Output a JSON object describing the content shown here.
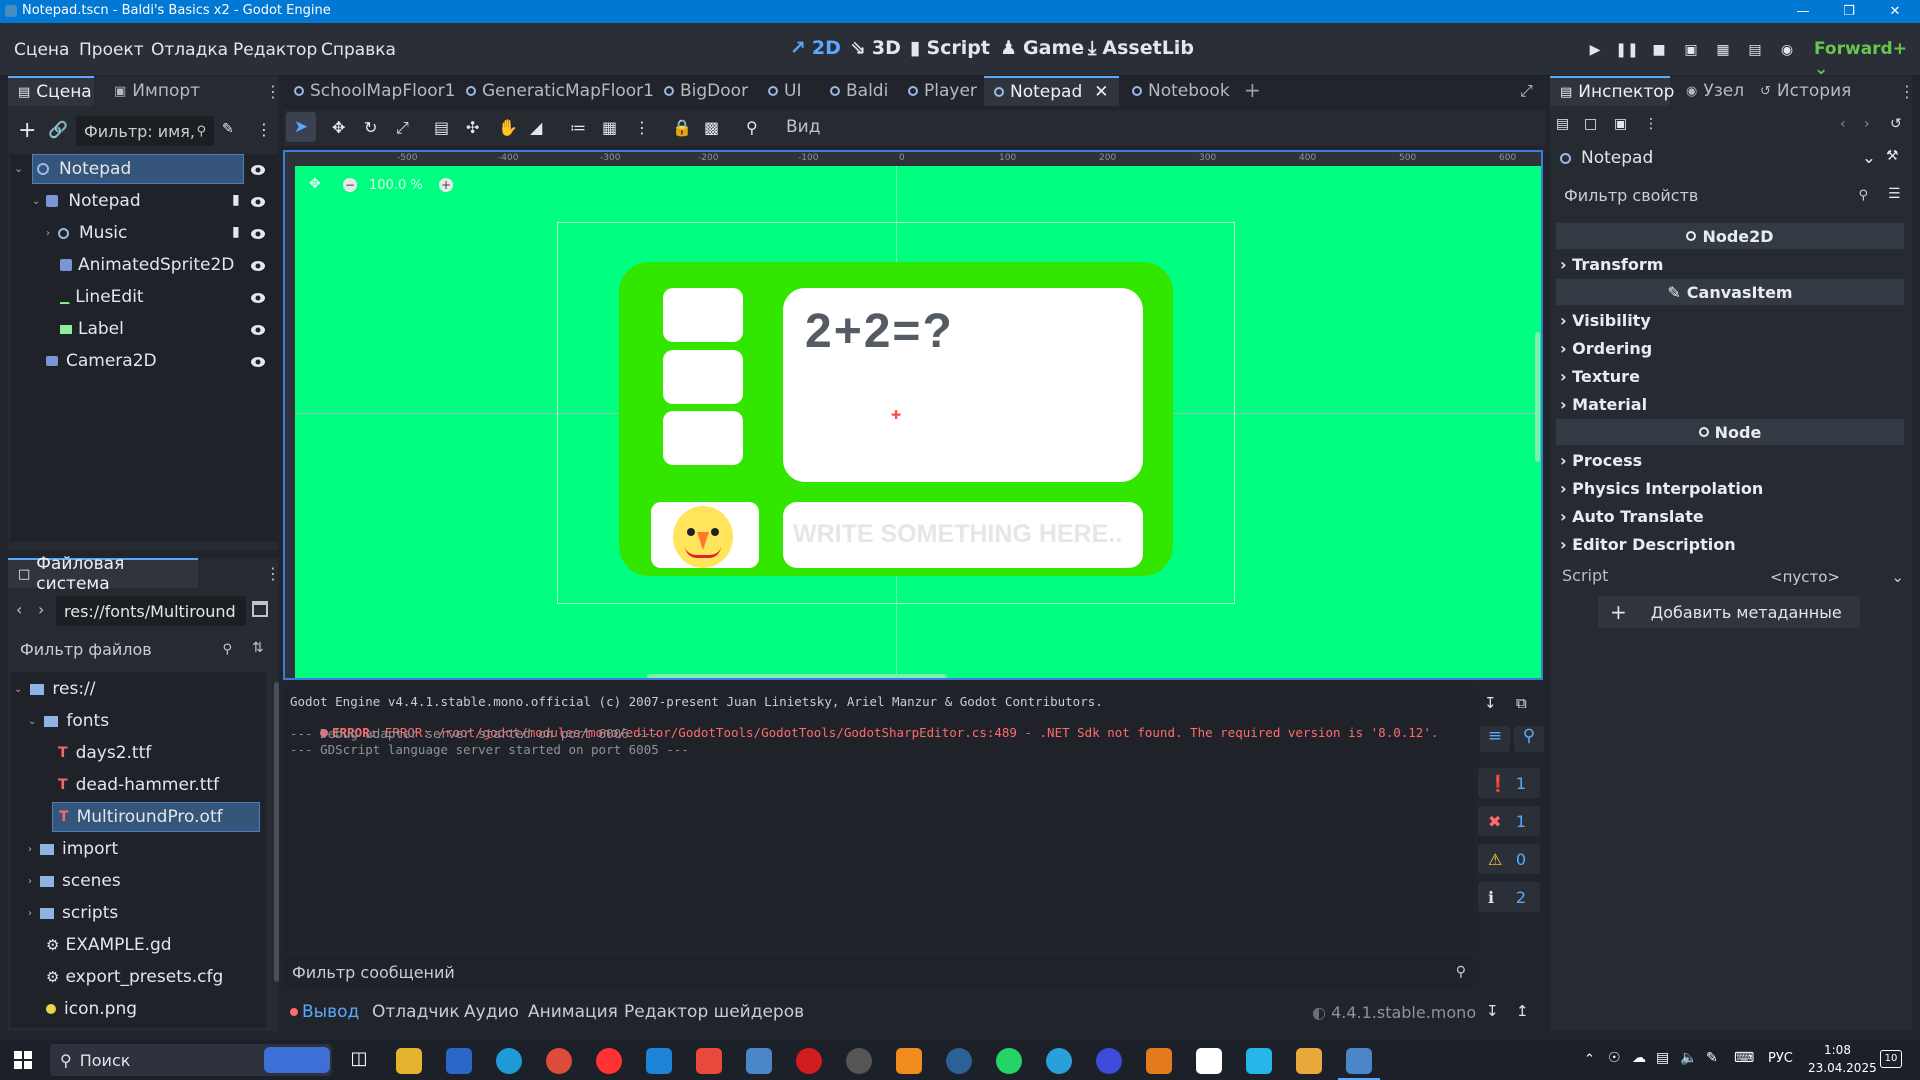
{
  "window": {
    "title": "Notepad.tscn - Baldi's Basics x2 - Godot Engine"
  },
  "menu": {
    "items": [
      "Сцена",
      "Проект",
      "Отладка",
      "Редактор",
      "Справка"
    ],
    "main_screens": [
      "2D",
      "3D",
      "Script",
      "Game",
      "AssetLib"
    ],
    "renderer": "Forward+"
  },
  "scene_dock": {
    "tabs": [
      "Сцена",
      "Импорт"
    ],
    "filter_placeholder": "Фильтр: имя,",
    "tree": [
      {
        "label": "Notepad",
        "icon": "node2d-icon"
      },
      {
        "label": "Notepad",
        "icon": "sprite-icon"
      },
      {
        "label": "Music",
        "icon": "audio-icon"
      },
      {
        "label": "AnimatedSprite2D",
        "icon": "animated-sprite-icon"
      },
      {
        "label": "LineEdit",
        "icon": "lineedit-icon"
      },
      {
        "label": "Label",
        "icon": "label-icon"
      },
      {
        "label": "Camera2D",
        "icon": "camera-icon"
      }
    ]
  },
  "filesystem_dock": {
    "title": "Файловая система",
    "path": "res://fonts/Multiround",
    "filter_placeholder": "Фильтр файлов",
    "tree": [
      {
        "label": "res://"
      },
      {
        "label": "fonts"
      },
      {
        "label": "days2.ttf"
      },
      {
        "label": "dead-hammer.ttf"
      },
      {
        "label": "MultiroundPro.otf"
      },
      {
        "label": "import"
      },
      {
        "label": "scenes"
      },
      {
        "label": "scripts"
      },
      {
        "label": "EXAMPLE.gd"
      },
      {
        "label": "export_presets.cfg"
      },
      {
        "label": "icon.png"
      }
    ]
  },
  "scene_tabs": [
    "SchoolMapFloor1",
    "GeneraticMapFloor1",
    "BigDoor",
    "UI",
    "Baldi",
    "Player",
    "Notepad",
    "Notebook"
  ],
  "toolbar": {
    "view_label": "Вид"
  },
  "viewport": {
    "zoom": "100.0 %",
    "ruler_labels": [
      "-500",
      "-400",
      "-300",
      "-200",
      "-100",
      "0",
      "100",
      "200",
      "300",
      "400",
      "500",
      "600"
    ],
    "question_text": "2+2=?",
    "input_placeholder": "WRITE SOMETHING HERE..",
    "bg_color": "#00ff80",
    "panel_color": "#33e600"
  },
  "console": {
    "lines": [
      "Godot Engine v4.4.1.stable.mono.official (c) 2007-present Juan Linietsky, Ariel Manzur & Godot Contributors.",
      "ERROR: /root/godot/modules/mono/editor/GodotTools/GodotTools/GodotSharpEditor.cs:489 - .NET Sdk not found. The required version is '8.0.12'.",
      "--- Debug adapter server started on port 6006 ---",
      "--- GDScript language server started on port 6005 ---"
    ],
    "filter_placeholder": "Фильтр сообщений",
    "counts": {
      "log": "1",
      "errors": "1",
      "warnings": "0",
      "info": "2"
    }
  },
  "bottom_tabs": [
    "Вывод",
    "Отладчик",
    "Аудио",
    "Анимация",
    "Редактор шейдеров"
  ],
  "version": "4.4.1.stable.mono",
  "inspector": {
    "tabs": [
      "Инспектор",
      "Узел",
      "История"
    ],
    "node_name": "Notepad",
    "filter_placeholder": "Фильтр свойств",
    "sections": [
      {
        "type": "head",
        "label": "Node2D"
      },
      {
        "type": "cat",
        "label": "Transform"
      },
      {
        "type": "head",
        "label": "CanvasItem"
      },
      {
        "type": "cat",
        "label": "Visibility"
      },
      {
        "type": "cat",
        "label": "Ordering"
      },
      {
        "type": "cat",
        "label": "Texture"
      },
      {
        "type": "cat",
        "label": "Material"
      },
      {
        "type": "head",
        "label": "Node"
      },
      {
        "type": "cat",
        "label": "Process"
      },
      {
        "type": "cat",
        "label": "Physics Interpolation"
      },
      {
        "type": "cat",
        "label": "Auto Translate"
      },
      {
        "type": "cat",
        "label": "Editor Description"
      }
    ],
    "script_label": "Script",
    "script_value": "<пусто>",
    "add_meta_label": "Добавить метаданные"
  },
  "taskbar": {
    "search_label": "Поиск",
    "lang": "РУС",
    "time": "1:08",
    "date": "23.04.2025",
    "notifications": "10"
  }
}
